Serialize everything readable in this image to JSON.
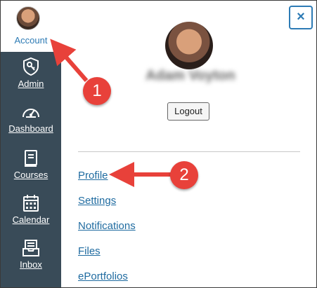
{
  "sidebar": {
    "account_label": "Account",
    "items": [
      {
        "label": "Admin",
        "icon": "shield-key-icon"
      },
      {
        "label": "Dashboard",
        "icon": "speedometer-icon"
      },
      {
        "label": "Courses",
        "icon": "book-icon"
      },
      {
        "label": "Calendar",
        "icon": "calendar-icon"
      },
      {
        "label": "Inbox",
        "icon": "inbox-icon"
      }
    ],
    "color": "#394b58"
  },
  "panel": {
    "close_glyph": "×",
    "user_name": "Adam Voyton",
    "logout_label": "Logout",
    "links": [
      "Profile",
      "Settings",
      "Notifications",
      "Files",
      "ePortfolios"
    ]
  },
  "annotations": {
    "badge_1": "1",
    "badge_2": "2",
    "color": "#e8413a"
  }
}
